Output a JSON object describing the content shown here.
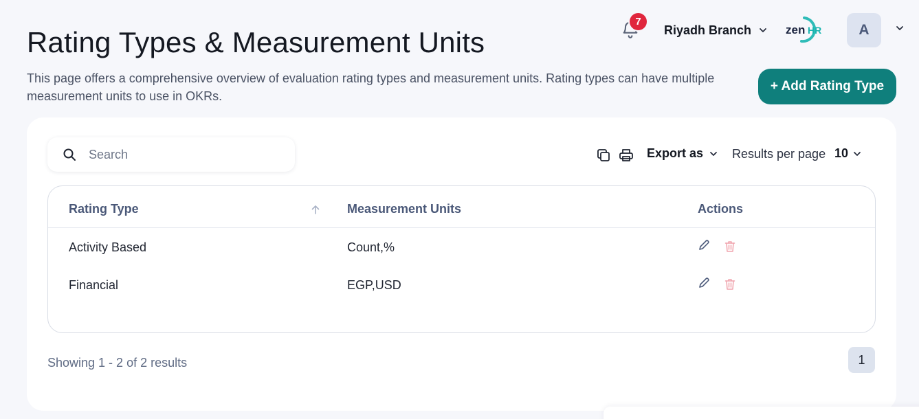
{
  "header": {
    "title": "Rating Types & Measurement Units",
    "description": "This page offers a comprehensive overview of evaluation rating types and measurement units. Rating types can have multiple measurement units to use in OKRs.",
    "notifications_count": "7",
    "branch": "Riyadh Branch",
    "logo_text_main": "zen",
    "logo_text_accent": "HR",
    "avatar_initial": "A",
    "add_button_label": "+ Add Rating Type"
  },
  "toolbar": {
    "search_placeholder": "Search",
    "export_label": "Export as",
    "results_per_page_label": "Results per page",
    "results_per_page_value": "10"
  },
  "table": {
    "columns": [
      "Rating Type",
      "Measurement Units",
      "Actions"
    ],
    "rows": [
      {
        "rating_type": "Activity Based",
        "units": "Count,%"
      },
      {
        "rating_type": "Financial",
        "units": "EGP,USD"
      }
    ]
  },
  "pagination": {
    "showing": "Showing 1 - 2 of 2 results",
    "current_page": "1"
  },
  "colors": {
    "accent": "#0f7f7c",
    "badge": "#e0263d",
    "delete": "#f0a4ad"
  }
}
